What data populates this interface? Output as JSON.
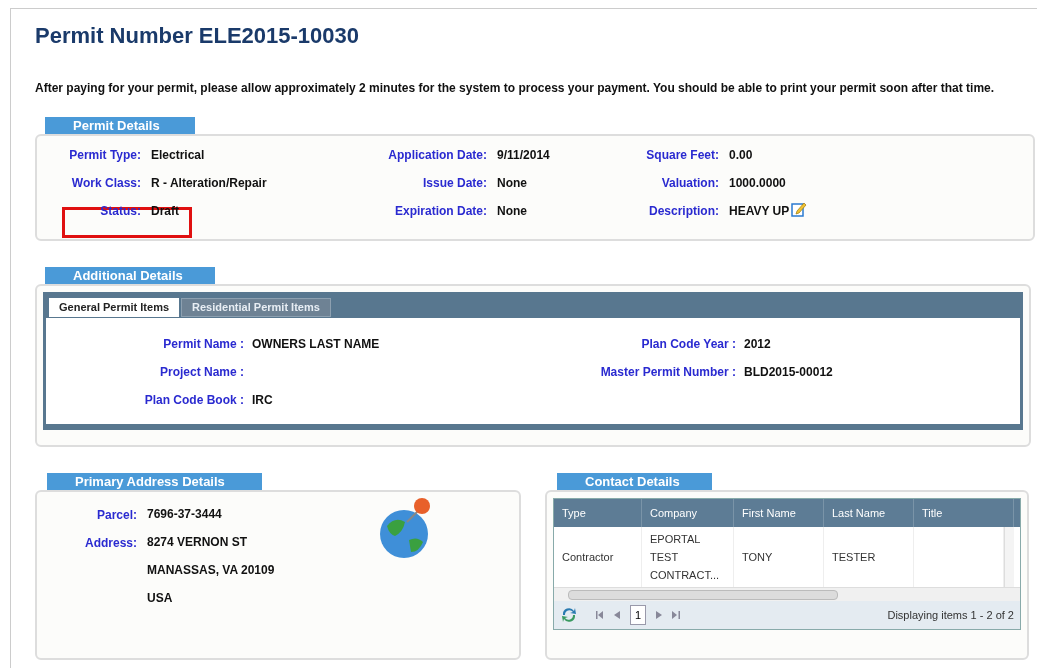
{
  "title": "Permit Number ELE2015-10030",
  "notice": "After paying for your permit, please allow approximately 2 minutes for the system to process your payment. You should be able to print your permit soon after that time.",
  "permit_details": {
    "heading": "Permit Details",
    "fields": [
      {
        "label": "Permit Type:",
        "value": "Electrical",
        "editable": false
      },
      {
        "label": "Application Date:",
        "value": "9/11/2014",
        "editable": false
      },
      {
        "label": "Square Feet:",
        "value": "0.00",
        "editable": false
      },
      {
        "label": "Work Class:",
        "value": "R - Alteration/Repair",
        "editable": false
      },
      {
        "label": "Issue Date:",
        "value": "None",
        "editable": false
      },
      {
        "label": "Valuation:",
        "value": "1000.0000",
        "editable": false
      },
      {
        "label": "Status:",
        "value": "Draft",
        "editable": false
      },
      {
        "label": "Expiration Date:",
        "value": "None",
        "editable": false
      },
      {
        "label": "Description:",
        "value": "HEAVY UP",
        "editable": true
      }
    ]
  },
  "additional_details": {
    "heading": "Additional Details",
    "tabs": [
      {
        "label": "General Permit Items",
        "selected": true
      },
      {
        "label": "Residential Permit Items",
        "selected": false
      }
    ],
    "left_fields": [
      {
        "label": "Permit Name :",
        "value": "OWNERS LAST NAME"
      },
      {
        "label": "Project Name :"
      },
      {
        "label": "Plan Code Book :",
        "value": "IRC"
      }
    ],
    "right_fields": [
      {
        "label": "Plan Code Year :",
        "value": "2012"
      },
      {
        "label": "Master Permit Number :",
        "value": "BLD2015-00012"
      }
    ]
  },
  "address": {
    "heading": "Primary Address Details",
    "parcel_label": "Parcel:",
    "parcel": "7696-37-3444",
    "address_label": "Address:",
    "lines": [
      "8274 VERNON ST",
      "MANASSAS, VA 20109",
      "USA"
    ]
  },
  "contacts": {
    "heading": "Contact Details",
    "columns": [
      "Type",
      "Company",
      "First Name",
      "Last Name",
      "Title"
    ],
    "rows": [
      [
        "Contractor",
        "EPORTAL TEST CONTRACT...",
        "TONY",
        "TESTER",
        ""
      ]
    ],
    "pager": {
      "page": "1",
      "status": "Displaying items 1 - 2 of 2"
    }
  }
}
